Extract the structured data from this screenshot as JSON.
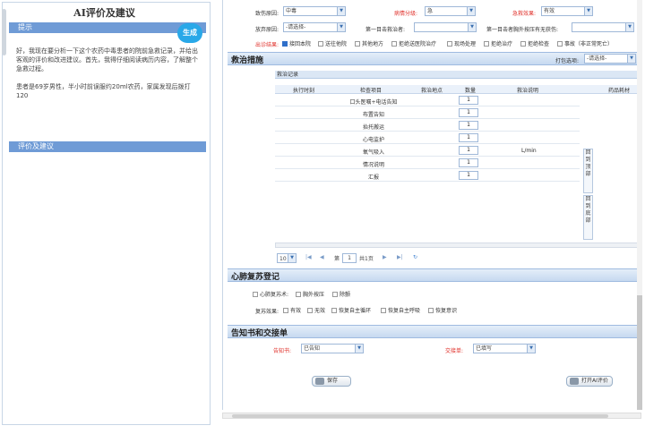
{
  "ai_panel": {
    "title": "AI评价及建议",
    "hint_header": "提示",
    "generate_label": "生成",
    "intro_text": "好，我现在要分析一下这个农药中毒患者的院前急救记录，并给出客观的评价和改进建议。首先，我得仔细阅读病历内容，了解整个急救过程。",
    "patient_text": "患者是69岁男性，半小时前误服约20ml农药，家属发现后拨打120",
    "eval_header": "评价及建议"
  },
  "form_top": {
    "cause_label": "致伤原因:",
    "cause_value": "中毒",
    "severity_label": "病情分级:",
    "severity_value": "急",
    "effect_label": "急救效果:",
    "effect_value": "有效",
    "abandon_label": "放弃原因:",
    "abandon_value": "-请选择-",
    "first_witness_label": "第一目击救治者:",
    "first_witness_value": "",
    "first_cpr_label": "第一目击者胸外按压有无获伤:",
    "first_cpr_value": "",
    "outcome_label": "出诊结果:",
    "outcome_options": [
      {
        "label": "接回本院",
        "checked": true
      },
      {
        "label": "送往他院",
        "checked": false
      },
      {
        "label": "其他地方",
        "checked": false
      },
      {
        "label": "拒绝送医院治疗",
        "checked": false
      },
      {
        "label": "现场处理",
        "checked": false
      },
      {
        "label": "拒绝治疗",
        "checked": false
      },
      {
        "label": "拒绝检查",
        "checked": false
      },
      {
        "label": "事故（非正常死亡）",
        "checked": false
      }
    ]
  },
  "rescue": {
    "title": "救治措施",
    "template_label": "打包选项:",
    "template_value": "-请选择-",
    "grid_title": "救治记录",
    "columns": [
      "执行时刻",
      "检查项目",
      "救治地点",
      "数量",
      "救治说明",
      "药品耗材"
    ],
    "rows": [
      {
        "item": "口头医嘱+电话告知",
        "qty": "1",
        "desc": ""
      },
      {
        "item": "布置告知",
        "qty": "1",
        "desc": ""
      },
      {
        "item": "抬托搬运",
        "qty": "1",
        "desc": ""
      },
      {
        "item": "心电监护",
        "qty": "1",
        "desc": ""
      },
      {
        "item": "氧气吸入",
        "qty": "1",
        "desc": "L/min"
      },
      {
        "item": "情况说明",
        "qty": "1",
        "desc": ""
      },
      {
        "item": "汇报",
        "qty": "1",
        "desc": ""
      }
    ],
    "side_buttons": [
      "回到顶部",
      "回到底部"
    ],
    "pager": {
      "page_size": "10",
      "page_prefix": "第",
      "page_value": "1",
      "page_suffix": "共1页"
    }
  },
  "cpr": {
    "title": "心肺复苏登记",
    "technique_label": "心肺复苏术:",
    "technique_options": [
      "胸外按压",
      "除颤"
    ],
    "result_label": "复苏效果:",
    "result_options": [
      "有效",
      "无效",
      "恢复自主循环",
      "恢复自主呼吸",
      "恢复意识"
    ]
  },
  "notice": {
    "title": "告知书和交接单",
    "notice_label": "告知书:",
    "notice_value": "已告知",
    "handover_label": "交接单:",
    "handover_value": "已填写",
    "save_label": "保存",
    "open_eval_label": "打开AI评价"
  }
}
